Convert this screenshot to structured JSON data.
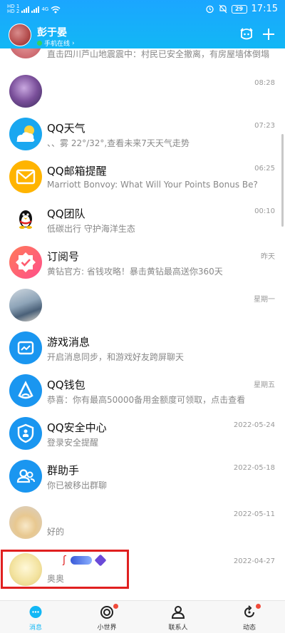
{
  "status_bar": {
    "sim1": "HD 1",
    "sim2": "HD 2",
    "net": "4G",
    "battery": "29",
    "time": "17:15"
  },
  "header": {
    "name": "彭于晏",
    "status": "手机在线",
    "status_chevron": "›",
    "accent": "#12b7f5"
  },
  "conversations": [
    {
      "title": "",
      "subtitle": "直击四川芦山地震震中：村民已安全撤离，有房屋墙体倒塌",
      "time": "",
      "avatar": "news-avatar"
    },
    {
      "title": "",
      "subtitle": "",
      "time": "08:28",
      "avatar": "user-avatar-purple"
    },
    {
      "title": "QQ天气",
      "subtitle": "、、雾 22°/32°,查看未来7天天气走势",
      "time": "07:23",
      "avatar": "weather-icon"
    },
    {
      "title": "QQ邮箱提醒",
      "subtitle": "Marriott Bonvoy: What Will Your Points Bonus Be?",
      "time": "06:25",
      "avatar": "mail-icon"
    },
    {
      "title": "QQ团队",
      "subtitle": "低碳出行 守护海洋生态",
      "time": "00:10",
      "avatar": "penguin-icon"
    },
    {
      "title": "订阅号",
      "subtitle": "黄钻官方: 省钱攻略！暴击黄钻最高送你360天",
      "time": "昨天",
      "avatar": "badge-check-icon"
    },
    {
      "title": "",
      "subtitle": "",
      "time": "星期一",
      "avatar": "user-avatar-photo"
    },
    {
      "title": "游戏消息",
      "subtitle": "开启消息同步，和游戏好友跨屏聊天",
      "time": "",
      "avatar": "game-icon"
    },
    {
      "title": "QQ钱包",
      "subtitle": "恭喜：你有最高50000备用金额度可领取，点击查看",
      "time": "星期五",
      "avatar": "wallet-icon"
    },
    {
      "title": "QQ安全中心",
      "subtitle": "登录安全提醒",
      "time": "2022-05-24",
      "avatar": "shield-icon"
    },
    {
      "title": "群助手",
      "subtitle": "你已被移出群聊",
      "time": "2022-05-18",
      "avatar": "group-icon"
    },
    {
      "title": "",
      "subtitle": "好的",
      "time": "2022-05-11",
      "avatar": "user-avatar-cartoon"
    },
    {
      "title": "",
      "subtitle": "奥奥",
      "time": "2022-04-27",
      "avatar": "user-avatar-sketch"
    }
  ],
  "tabs": [
    {
      "label": "消息",
      "icon": "chat-icon",
      "active": true
    },
    {
      "label": "小世界",
      "icon": "planet-icon",
      "active": false
    },
    {
      "label": "联系人",
      "icon": "contacts-icon",
      "active": false
    },
    {
      "label": "动态",
      "icon": "refresh-icon",
      "active": false
    }
  ],
  "colors": {
    "accent": "#12b7f5",
    "badge": "#f04a3a",
    "highlight": "#e02020"
  }
}
